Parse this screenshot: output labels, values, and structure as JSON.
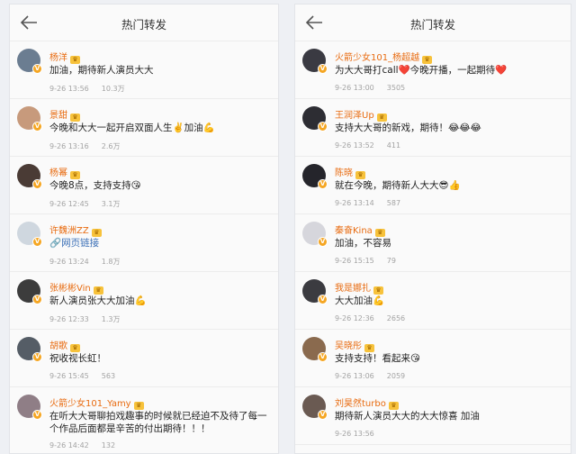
{
  "left": {
    "title": "热门转发",
    "items": [
      {
        "name": "杨洋",
        "text": "加油，期待新人演员大大",
        "time": "9-26 13:56",
        "count": "10.3万",
        "avatar_color": "#6b7d91"
      },
      {
        "name": "景甜",
        "text": "今晚和大大一起开启双面人生✌️加油💪",
        "time": "9-26 13:16",
        "count": "2.6万",
        "avatar_color": "#c79a7c"
      },
      {
        "name": "杨幂",
        "text": "今晚8点，支持支持😘",
        "time": "9-26 12:45",
        "count": "3.1万",
        "avatar_color": "#4a3b35"
      },
      {
        "name": "许魏洲ZZ",
        "text": "🔗网页链接",
        "time": "9-26 13:24",
        "count": "1.8万",
        "avatar_color": "#cfd7df"
      },
      {
        "name": "张彬彬Vin",
        "text": "新人演员张大大加油💪",
        "time": "9-26 12:33",
        "count": "1.3万",
        "avatar_color": "#3c3c3c"
      },
      {
        "name": "胡歌",
        "text": "祝收视长虹！",
        "time": "9-26 15:45",
        "count": "563",
        "avatar_color": "#555d66"
      },
      {
        "name": "火箭少女101_Yamy",
        "text": "在听大大哥聊拍戏趣事的时候就已经迫不及待了每一个作品后面都是辛苦的付出期待！！！",
        "time": "9-26 14:42",
        "count": "132",
        "avatar_color": "#8f7e86"
      }
    ]
  },
  "right": {
    "title": "热门转发",
    "items": [
      {
        "name": "火箭少女101_杨超越",
        "text": "为大大哥打call❤️今晚开播，一起期待❤️",
        "time": "9-26 13:00",
        "count": "3505",
        "avatar_color": "#3a3a42"
      },
      {
        "name": "王润泽Up",
        "text": "支持大大哥的新戏，期待！😂😂😂",
        "time": "9-26 13:52",
        "count": "411",
        "avatar_color": "#2d2d33"
      },
      {
        "name": "陈晓",
        "text": "就在今晚，期待新人大大😎👍",
        "time": "9-26 13:14",
        "count": "587",
        "avatar_color": "#25252b"
      },
      {
        "name": "秦奋Kina",
        "text": "加油，不容易",
        "time": "9-26 15:15",
        "count": "79",
        "avatar_color": "#d6d6dc"
      },
      {
        "name": "我是娜扎",
        "text": "大大加油💪",
        "time": "9-26 12:36",
        "count": "2656",
        "avatar_color": "#3b3b40"
      },
      {
        "name": "吴晓彤",
        "text": "支持支持！看起来😘",
        "time": "9-26 13:06",
        "count": "2059",
        "avatar_color": "#8a6a4e"
      },
      {
        "name": "刘昊然turbo",
        "text": "期待新人演员大大的大大惊喜 加油",
        "time": "9-26 13:56",
        "count": "",
        "avatar_color": "#6a5a52"
      }
    ]
  }
}
